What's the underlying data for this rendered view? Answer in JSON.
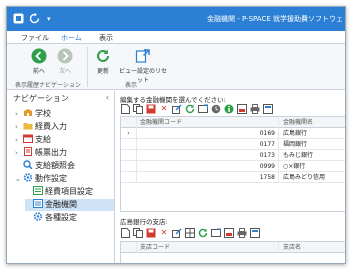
{
  "titlebar": {
    "title": "金融機関 - P-SPACE 就学援助費ソフトウェ",
    "app_icon": "app-logo",
    "refresh_icon": "refresh-icon",
    "dropdown_icon": "chevron-down-icon"
  },
  "tabs": [
    {
      "label": "ファイル"
    },
    {
      "label": "ホーム"
    },
    {
      "label": "表示"
    }
  ],
  "ribbon": {
    "back_label": "前へ",
    "forward_label": "次へ",
    "refresh_label": "更新",
    "reset_view_label": "ビュー設定のリセット",
    "group_history": "表示履歴ナビゲーション",
    "group_view": "表示"
  },
  "nav": {
    "heading": "ナビゲーション",
    "collapse": "‹",
    "items": [
      {
        "label": "学校",
        "expand": "›",
        "icon": "school-icon"
      },
      {
        "label": "経費入力",
        "expand": "›",
        "icon": "folder-icon"
      },
      {
        "label": "支給",
        "expand": "›",
        "icon": "calendar-icon"
      },
      {
        "label": "帳票出力",
        "expand": "›",
        "icon": "report-icon"
      },
      {
        "label": "支給額照会",
        "expand": "",
        "icon": "search-icon"
      },
      {
        "label": "動作設定",
        "expand": "⌄",
        "icon": "gear-icon"
      },
      {
        "label": "経費項目設定",
        "expand": "",
        "icon": "list-icon"
      },
      {
        "label": "金融機関",
        "expand": "",
        "icon": "bank-icon"
      },
      {
        "label": "各種設定",
        "expand": "",
        "icon": "gear-icon"
      }
    ]
  },
  "banks": {
    "prompt": "編集する金融機関を選んでください:",
    "columns": {
      "code": "金融機関コード",
      "name": "金融機関名"
    },
    "rows": [
      {
        "mark": "›",
        "code": "0169",
        "name": "広島銀行"
      },
      {
        "mark": "",
        "code": "0177",
        "name": "福岡銀行"
      },
      {
        "mark": "",
        "code": "0173",
        "name": "もみじ銀行"
      },
      {
        "mark": "",
        "code": "0999",
        "name": "○×銀行"
      },
      {
        "mark": "",
        "code": "1758",
        "name": "広島みどり信用"
      }
    ]
  },
  "branches": {
    "prompt": "広島銀行の支店:",
    "columns": {
      "code": "支店コード",
      "name": "支店名"
    }
  },
  "colors": {
    "titlebar": "#2b7fd4",
    "selected": "#cfe3f6",
    "green": "#2e9e48",
    "red": "#d03a2f"
  }
}
